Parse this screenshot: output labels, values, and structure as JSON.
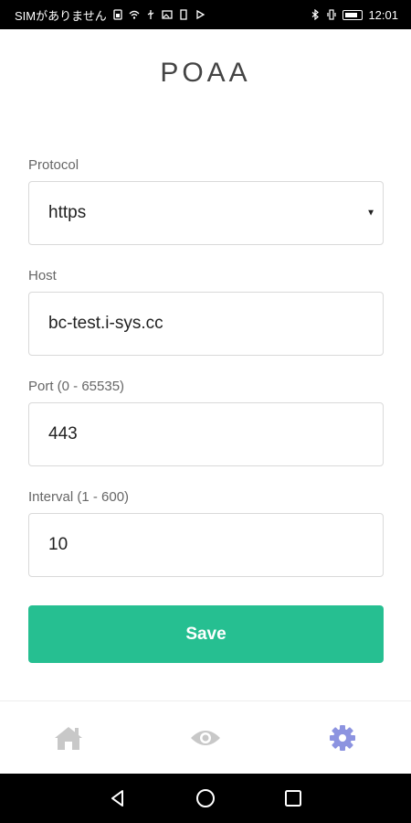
{
  "status_bar": {
    "carrier": "SIMがありません",
    "time": "12:01"
  },
  "app": {
    "title": "POAA"
  },
  "form": {
    "protocol": {
      "label": "Protocol",
      "value": "https"
    },
    "host": {
      "label": "Host",
      "value": "bc-test.i-sys.cc"
    },
    "port": {
      "label": "Port (0 - 65535)",
      "value": "443"
    },
    "interval": {
      "label": "Interval (1 - 600)",
      "value": "10"
    },
    "save_label": "Save"
  },
  "colors": {
    "accent": "#26bf91",
    "tab_inactive": "#c8c8c8",
    "tab_active": "#8c93e0"
  },
  "tabs": [
    {
      "icon": "home-icon",
      "active": false
    },
    {
      "icon": "eye-icon",
      "active": false
    },
    {
      "icon": "gear-icon",
      "active": true
    }
  ],
  "nav_buttons": [
    "back-icon",
    "home-circle-icon",
    "recents-icon"
  ]
}
